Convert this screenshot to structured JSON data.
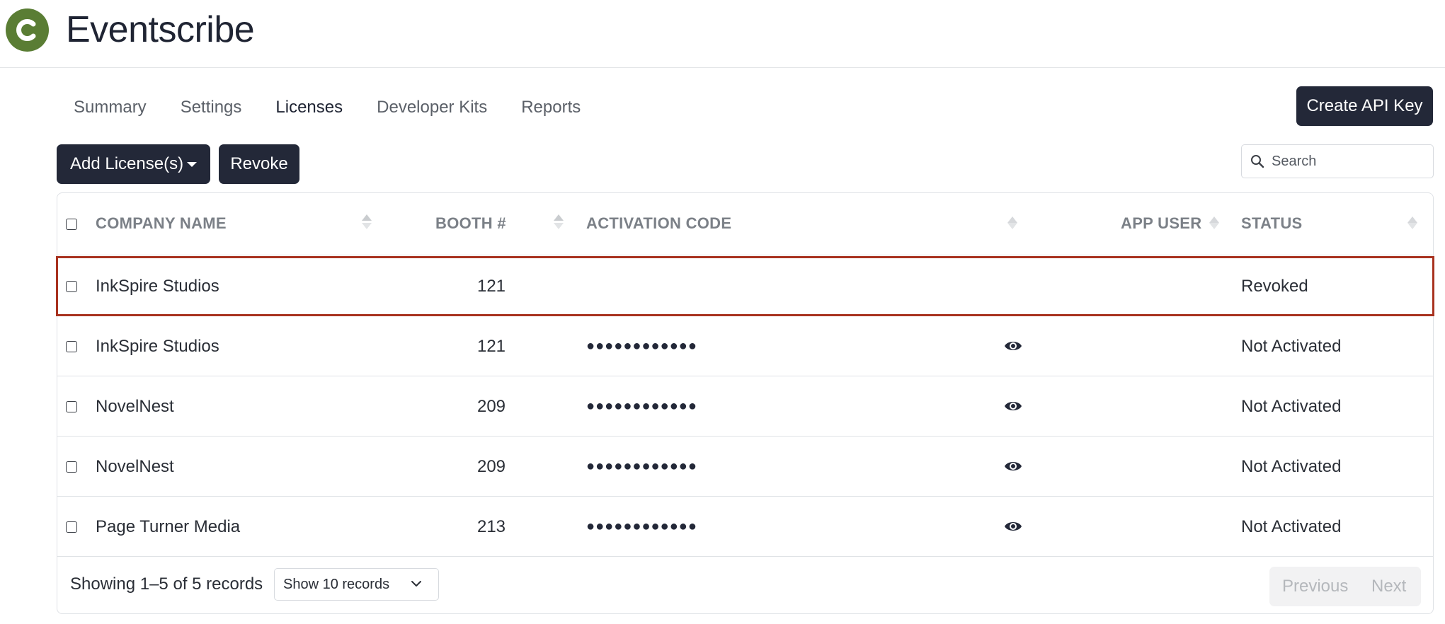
{
  "app": {
    "name": "Eventscribe",
    "logo_letter": "C",
    "brand_color": "#5a7d34"
  },
  "tabs": [
    {
      "label": "Summary",
      "active": false
    },
    {
      "label": "Settings",
      "active": false
    },
    {
      "label": "Licenses",
      "active": true
    },
    {
      "label": "Developer Kits",
      "active": false
    },
    {
      "label": "Reports",
      "active": false
    }
  ],
  "actions": {
    "create_api_key": "Create API Key",
    "add_licenses": "Add License(s)",
    "revoke": "Revoke"
  },
  "search": {
    "placeholder": "Search",
    "value": ""
  },
  "table": {
    "columns": {
      "company": "COMPANY NAME",
      "booth": "BOOTH #",
      "activation_code": "ACTIVATION CODE",
      "app_user": "APP USER",
      "status": "STATUS"
    },
    "rows": [
      {
        "company": "InkSpire Studios",
        "booth": "121",
        "activation_code": "",
        "app_user": "",
        "status": "Revoked",
        "highlighted": true
      },
      {
        "company": "InkSpire Studios",
        "booth": "121",
        "activation_code": "●●●●●●●●●●●●",
        "app_user": "",
        "status": "Not Activated",
        "highlighted": false
      },
      {
        "company": "NovelNest",
        "booth": "209",
        "activation_code": "●●●●●●●●●●●●",
        "app_user": "",
        "status": "Not Activated",
        "highlighted": false
      },
      {
        "company": "NovelNest",
        "booth": "209",
        "activation_code": "●●●●●●●●●●●●",
        "app_user": "",
        "status": "Not Activated",
        "highlighted": false
      },
      {
        "company": "Page Turner Media",
        "booth": "213",
        "activation_code": "●●●●●●●●●●●●",
        "app_user": "",
        "status": "Not Activated",
        "highlighted": false
      }
    ],
    "highlight_color": "#a8321f"
  },
  "footer": {
    "showing": "Showing 1–5 of 5 records",
    "per_page": "Show 10 records",
    "previous": "Previous",
    "next": "Next"
  }
}
